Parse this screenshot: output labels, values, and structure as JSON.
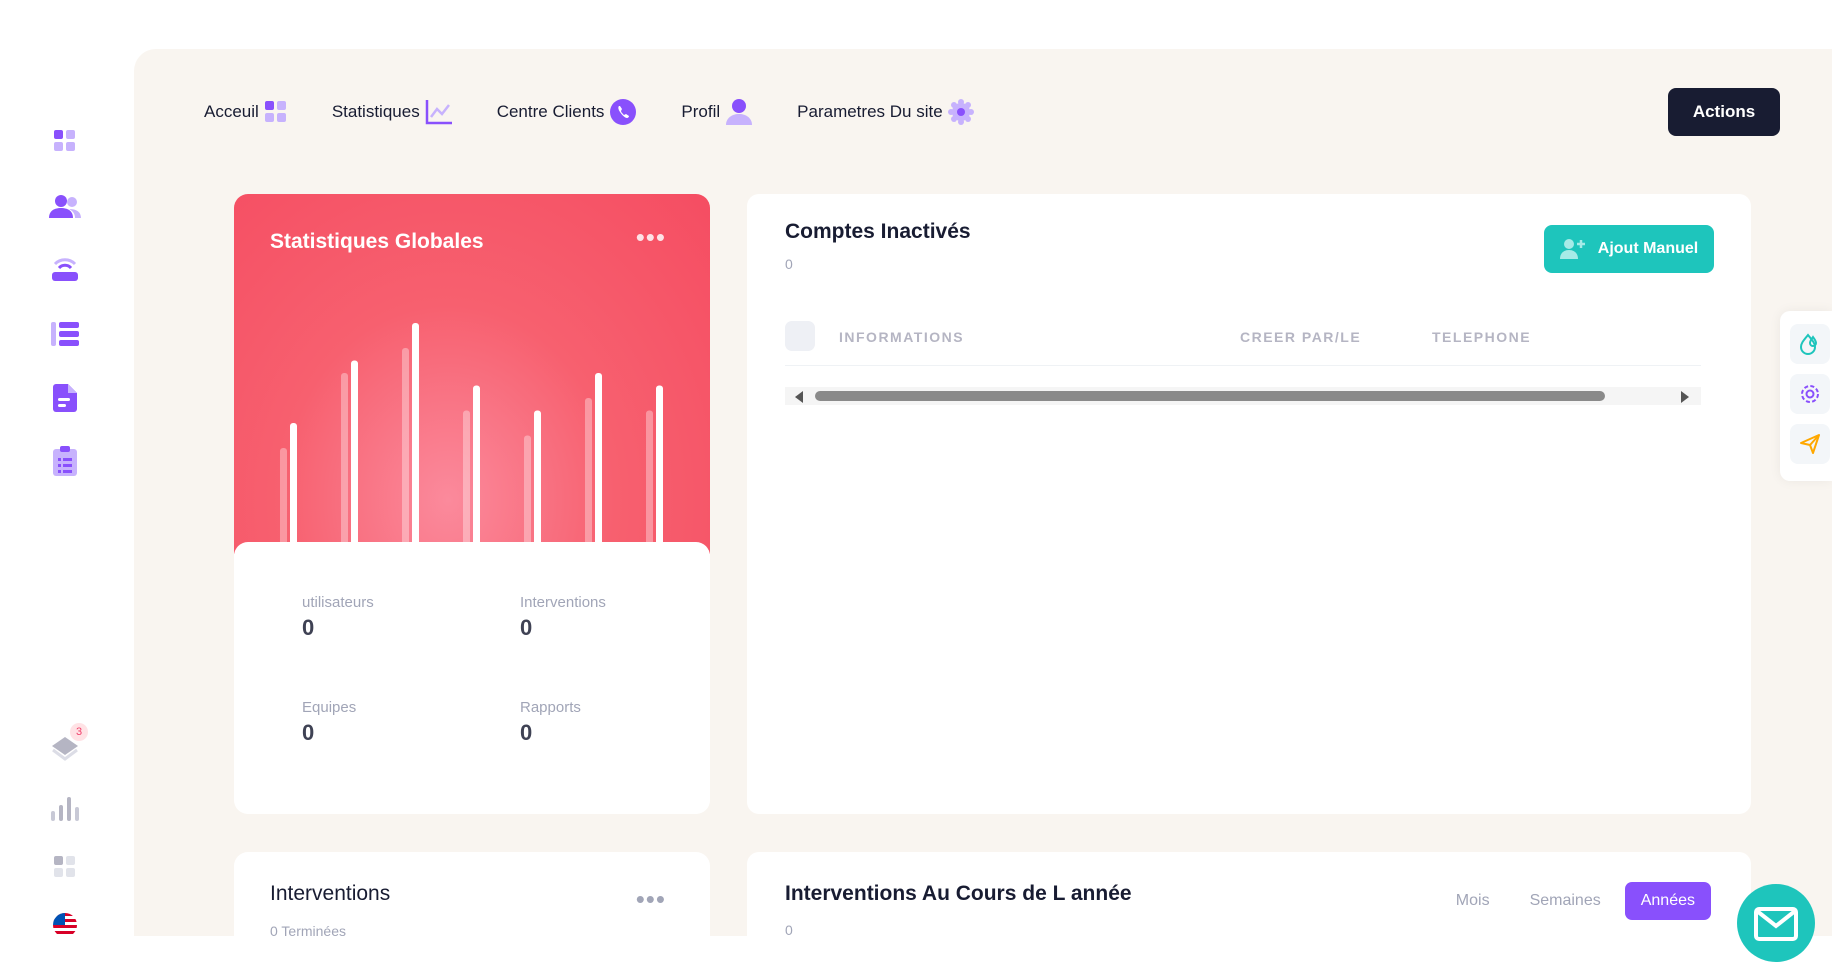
{
  "nav": {
    "items": [
      {
        "label": "Acceuil",
        "icon": "dashboard-icon"
      },
      {
        "label": "Statistiques",
        "icon": "chart-line-icon"
      },
      {
        "label": "Centre Clients",
        "icon": "phone-icon"
      },
      {
        "label": "Profil",
        "icon": "user-icon"
      },
      {
        "label": "Parametres Du site",
        "icon": "settings-icon"
      }
    ],
    "actions_label": "Actions"
  },
  "sidebar": {
    "notifications_count": "3",
    "icons": [
      "dashboard-icon",
      "users-icon",
      "router-icon",
      "list-icon",
      "document-icon",
      "clipboard-icon",
      "layers-icon",
      "bar-chart-icon",
      "apps-icon",
      "us-flag-icon"
    ]
  },
  "stats_card": {
    "title": "Statistiques Globales",
    "metrics": [
      {
        "label": "utilisateurs",
        "value": "0"
      },
      {
        "label": "Interventions",
        "value": "0"
      },
      {
        "label": "Equipes",
        "value": "0"
      },
      {
        "label": "Rapports",
        "value": "0"
      }
    ]
  },
  "chart_data": {
    "type": "bar",
    "series": [
      {
        "values": [
          40,
          70,
          80,
          55,
          45,
          60,
          55
        ]
      },
      {
        "values": [
          50,
          75,
          90,
          65,
          55,
          70,
          65
        ]
      }
    ],
    "ylim": [
      0,
      100
    ],
    "grid": false,
    "legend": "none"
  },
  "accounts_card": {
    "title": "Comptes Inactivés",
    "count": "0",
    "add_button_label": "Ajout Manuel",
    "columns": [
      "INFORMATIONS",
      "CREER PAR/LE",
      "TELEPHONE"
    ]
  },
  "interventions_card": {
    "title": "Interventions",
    "subtitle": "0 Terminées"
  },
  "year_card": {
    "title": "Interventions Au Cours de L année",
    "count": "0",
    "tabs": [
      {
        "label": "Mois",
        "active": false
      },
      {
        "label": "Semaines",
        "active": false
      },
      {
        "label": "Années",
        "active": true
      }
    ]
  },
  "colors": {
    "primary": "#8950fc",
    "dark": "#181c32",
    "teal": "#1ec5bc",
    "danger": "#f54d62",
    "muted": "#a1a5b7"
  }
}
